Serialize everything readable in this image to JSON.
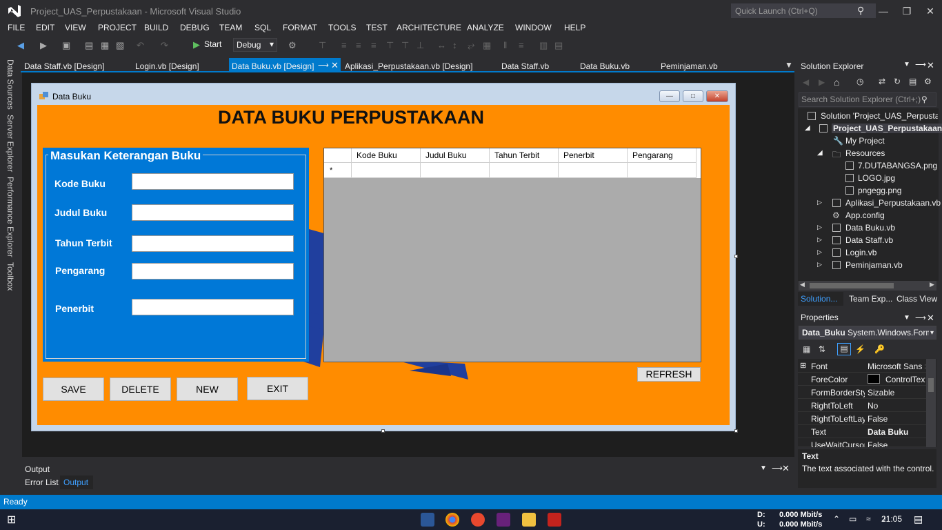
{
  "window": {
    "title": "Project_UAS_Perpustakaan - Microsoft Visual Studio",
    "quick_launch_placeholder": "Quick Launch (Ctrl+Q)"
  },
  "menu": [
    "FILE",
    "EDIT",
    "VIEW",
    "PROJECT",
    "BUILD",
    "DEBUG",
    "TEAM",
    "SQL",
    "FORMAT",
    "TOOLS",
    "TEST",
    "ARCHITECTURE",
    "ANALYZE",
    "WINDOW",
    "HELP"
  ],
  "toolbar": {
    "start_label": "Start",
    "config": "Debug"
  },
  "left_rail": [
    "Data Sources",
    "Server Explorer",
    "Performance Explorer",
    "Toolbox"
  ],
  "doc_tabs": [
    "Data Staff.vb [Design]",
    "Login.vb [Design]",
    "Data Buku.vb [Design]",
    "Aplikasi_Perpustakaan.vb [Design]",
    "Data Staff.vb",
    "Data Buku.vb",
    "Peminjaman.vb"
  ],
  "form": {
    "title": "Data Buku",
    "heading": "DATA BUKU PERPUSTAKAAN",
    "group_title": "Masukan Keterangan Buku",
    "labels": [
      "Kode Buku",
      "Judul Buku",
      "Tahun Terbit",
      "Pengarang",
      "Penerbit"
    ],
    "grid_columns": [
      "Kode Buku",
      "Judul Buku",
      "Tahun Terbit",
      "Penerbit",
      "Pengarang"
    ],
    "new_row_marker": "*",
    "buttons": [
      "SAVE",
      "DELETE",
      "NEW",
      "EXIT"
    ],
    "refresh": "REFRESH"
  },
  "solution": {
    "title": "Solution Explorer",
    "search_placeholder": "Search Solution Explorer (Ctrl+;)",
    "items": [
      "Solution 'Project_UAS_Perpustakaan'",
      "Project_UAS_Perpustakaan",
      "My Project",
      "Resources",
      "7.DUTABANGSA.png",
      "LOGO.jpg",
      "pngegg.png",
      "Aplikasi_Perpustakaan.vb",
      "App.config",
      "Data Buku.vb",
      "Data Staff.vb",
      "Login.vb",
      "Peminjaman.vb"
    ],
    "tabs": [
      "Solution...",
      "Team Exp...",
      "Class View"
    ]
  },
  "properties": {
    "title": "Properties",
    "object_name": "Data_Buku",
    "object_type": "System.Windows.Forms.Form",
    "rows": [
      {
        "name": "Font",
        "value": "Microsoft Sans Serif"
      },
      {
        "name": "ForeColor",
        "value": "ControlText"
      },
      {
        "name": "FormBorderStyle",
        "value": "Sizable"
      },
      {
        "name": "RightToLeft",
        "value": "No"
      },
      {
        "name": "RightToLeftLayout",
        "value": "False"
      },
      {
        "name": "Text",
        "value": "Data Buku"
      },
      {
        "name": "UseWaitCursor",
        "value": "False"
      }
    ],
    "desc_title": "Text",
    "desc_text": "The text associated with the control."
  },
  "output": {
    "title": "Output",
    "tabs": [
      "Error List",
      "Output"
    ]
  },
  "status": "Ready",
  "taskbar": {
    "net_down_label": "D:",
    "net_down": "0.000 Mbit/s",
    "net_up_label": "U:",
    "net_up": "0.000 Mbit/s",
    "clock": "21:05"
  }
}
